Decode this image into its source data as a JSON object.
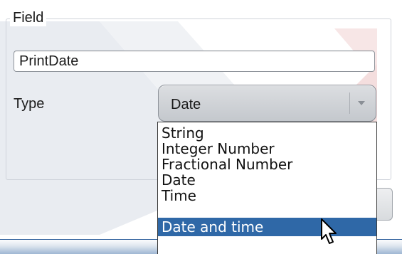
{
  "group": {
    "legend": "Field"
  },
  "field": {
    "value": "PrintDate"
  },
  "type_row": {
    "label": "Type",
    "selected_value": "Date"
  },
  "dropdown": {
    "options": [
      "String",
      "Integer Number",
      "Fractional Number",
      "Date",
      "Time",
      "Date and time"
    ],
    "highlighted": "Date and time"
  },
  "colors": {
    "selection": "#2f68a7",
    "bottom_bar": "#2e5f9c",
    "select_bg": "#d0d3d7"
  },
  "icons": [
    "chevron-down-icon",
    "mouse-pointer-icon"
  ]
}
